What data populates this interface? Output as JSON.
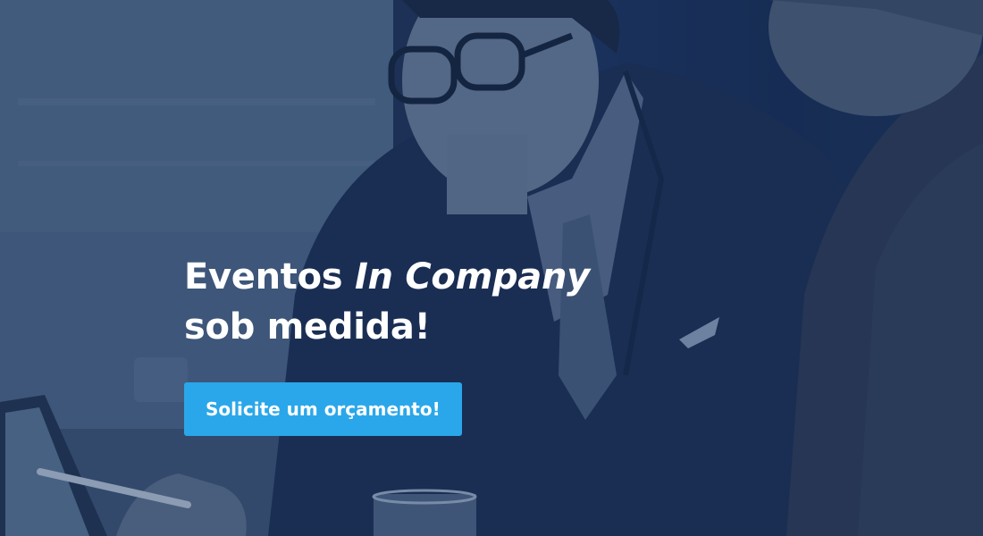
{
  "hero": {
    "title_line1_prefix": "Eventos",
    "title_line1_italic": "In Company",
    "title_line2": "sob medida!",
    "cta_label": "Solicite um orçamento!"
  },
  "colors": {
    "overlay": "#1d3560",
    "cta_background": "#2aa7ea",
    "text": "#ffffff"
  }
}
